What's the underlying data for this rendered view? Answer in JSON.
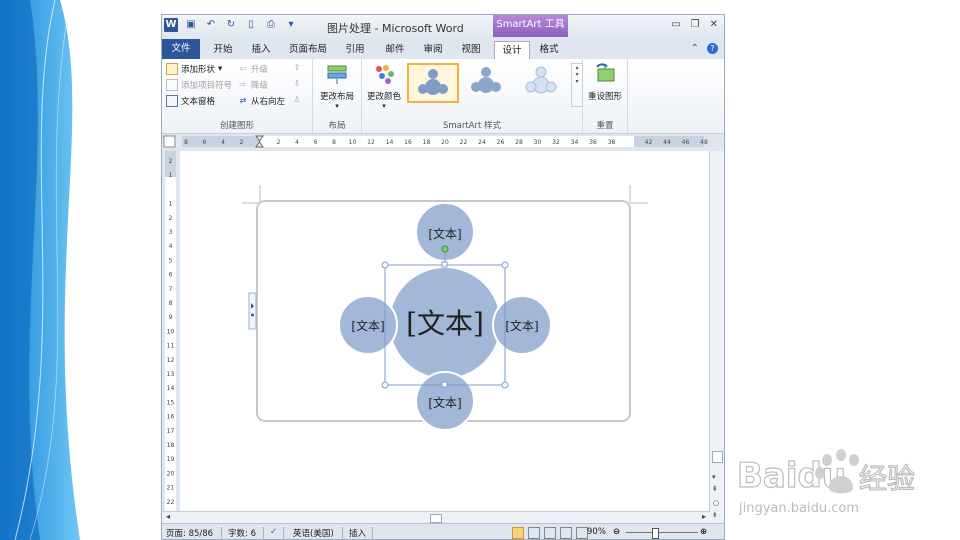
{
  "window": {
    "title": "图片处理 - Microsoft Word",
    "context_tab": "SmartArt 工具"
  },
  "tabs": [
    "文件",
    "开始",
    "插入",
    "页面布局",
    "引用",
    "邮件",
    "审阅",
    "视图",
    "设计",
    "格式"
  ],
  "ribbon": {
    "create_graphic": {
      "add_shape": "添加形状",
      "add_bullet": "添加项目符号",
      "text_pane": "文本窗格",
      "promote": "升级",
      "demote": "降级",
      "right_to_left": "从右向左",
      "label": "创建图形"
    },
    "layout": {
      "change_layout": "更改布局",
      "label": "布局"
    },
    "styles": {
      "change_colors": "更改颜色",
      "label": "SmartArt 样式"
    },
    "reset": {
      "reset_graphic": "重设图形",
      "label": "重置"
    }
  },
  "ruler_numbers": [
    "8",
    "6",
    "4",
    "2",
    "",
    "2",
    "4",
    "6",
    "8",
    "10",
    "12",
    "14",
    "16",
    "18",
    "20",
    "22",
    "24",
    "26",
    "28",
    "30",
    "32",
    "34",
    "36",
    "38",
    "",
    "42",
    "44",
    "46",
    "48"
  ],
  "vruler_numbers": [
    "2",
    "1",
    "",
    "1",
    "2",
    "3",
    "4",
    "5",
    "6",
    "7",
    "8",
    "9",
    "10",
    "11",
    "12",
    "13",
    "14",
    "15",
    "16",
    "17",
    "18",
    "19",
    "20",
    "21",
    "22"
  ],
  "smartart": {
    "center": "[文本]",
    "top": "[文本]",
    "left": "[文本]",
    "right": "[文本]",
    "bottom": "[文本]"
  },
  "status": {
    "page": "页面: 85/86",
    "words": "字数: 6",
    "language": "英语(美国)",
    "insert": "插入",
    "zoom": "90%"
  },
  "watermark": {
    "brand": "Baidu",
    "brand_cn": "经验",
    "url": "jingyan.baidu.com"
  },
  "colors": {
    "accent": "#2b579a",
    "smartart_fill": "#a3b8d8",
    "context_tab": "#9b6bc8"
  }
}
